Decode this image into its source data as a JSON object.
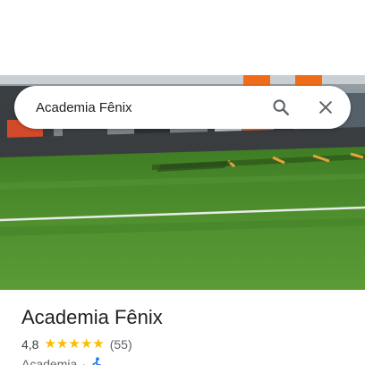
{
  "search": {
    "value": "Academia Fênix",
    "search_icon": "search-icon",
    "clear_icon": "close-icon"
  },
  "place": {
    "name": "Academia Fênix",
    "rating": "4,8",
    "stars": 5,
    "star_icon": "★",
    "review_count": "(55)",
    "category": "Academia",
    "separator": "·",
    "accessibility_icon": "wheelchair-icon"
  },
  "colors": {
    "star": "#fbbc04",
    "accessibility": "#1a73e8",
    "turf": "#4c8a2c",
    "title": "#202124",
    "secondary_text": "#5f6368"
  }
}
